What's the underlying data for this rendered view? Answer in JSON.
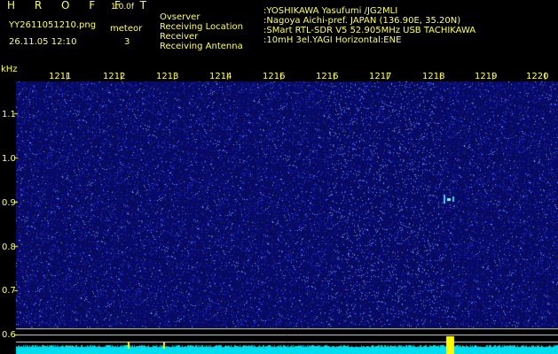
{
  "header": {
    "app_title": "H R O F F T",
    "version": "1.0.0f",
    "filename": "YY2611051210.png",
    "datetime": "26.11.05 12:10",
    "mode_label": "meteor",
    "meteor_count": "3"
  },
  "info": [
    {
      "label": "Ovserver",
      "value": ":YOSHIKAWA Yasufumi /JG2MLI"
    },
    {
      "label": "Receiving Location",
      "value": ":Nagoya Aichi-pref. JAPAN (136.90E, 35.20N)"
    },
    {
      "label": "Receiver",
      "value": ":SMart RTL-SDR V5 52.905MHz USB TACHIKAWA"
    },
    {
      "label": "Receiving Antenna",
      "value": ":10mH 3el.YAGI Horizontal:ENE"
    }
  ],
  "axis": {
    "unit": "kHz",
    "time_labels": [
      "1211",
      "1212",
      "1213",
      "1214",
      "1216",
      "1216",
      "1217",
      "1218",
      "1219",
      "1220"
    ],
    "freq_labels": [
      "1.1",
      "1.0",
      "0.9",
      "0.8",
      "0.7",
      "0.6"
    ]
  },
  "colors": {
    "background": "#000000",
    "noise": "#2a35a8",
    "text": "#ffff66",
    "baseline": "#00ddee",
    "echo": "#ffff00"
  }
}
